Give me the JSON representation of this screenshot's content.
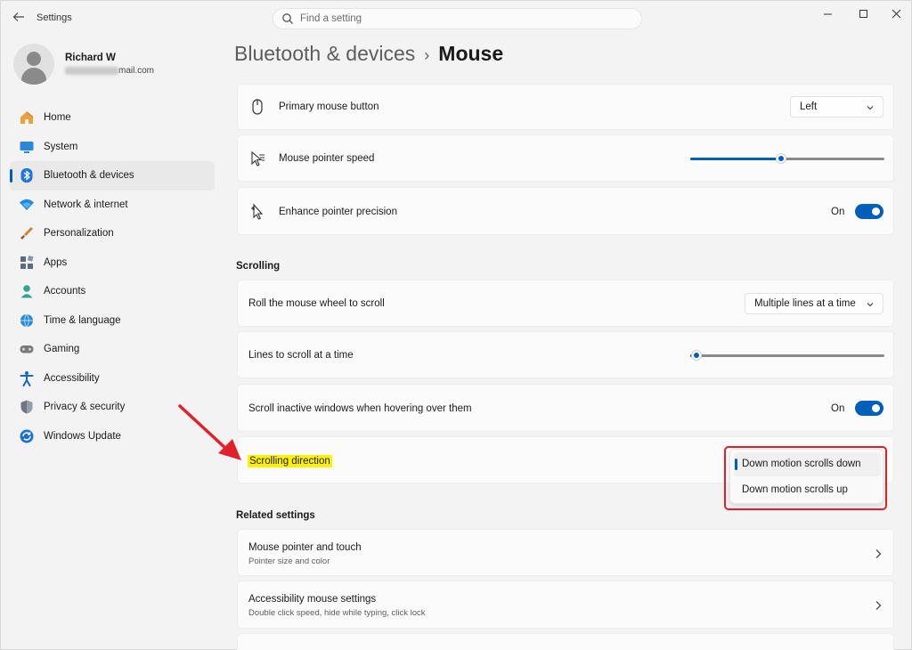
{
  "window": {
    "app_title": "Settings",
    "search_placeholder": "Find a setting"
  },
  "profile": {
    "name": "Richard W",
    "email_visible": "mail.com"
  },
  "sidebar": {
    "items": [
      {
        "label": "Home",
        "icon": "home-icon",
        "selected": false
      },
      {
        "label": "System",
        "icon": "system-icon",
        "selected": false
      },
      {
        "label": "Bluetooth & devices",
        "icon": "bluetooth-icon",
        "selected": true
      },
      {
        "label": "Network & internet",
        "icon": "network-icon",
        "selected": false
      },
      {
        "label": "Personalization",
        "icon": "personalization-icon",
        "selected": false
      },
      {
        "label": "Apps",
        "icon": "apps-icon",
        "selected": false
      },
      {
        "label": "Accounts",
        "icon": "accounts-icon",
        "selected": false
      },
      {
        "label": "Time & language",
        "icon": "time-language-icon",
        "selected": false
      },
      {
        "label": "Gaming",
        "icon": "gaming-icon",
        "selected": false
      },
      {
        "label": "Accessibility",
        "icon": "accessibility-icon",
        "selected": false
      },
      {
        "label": "Privacy & security",
        "icon": "shield-icon",
        "selected": false
      },
      {
        "label": "Windows Update",
        "icon": "windows-update-icon",
        "selected": false
      }
    ]
  },
  "header": {
    "parent": "Bluetooth & devices",
    "separator": "›",
    "current": "Mouse"
  },
  "settings": {
    "primary_button": {
      "label": "Primary mouse button",
      "value": "Left"
    },
    "pointer_speed": {
      "label": "Mouse pointer speed",
      "level": 0.47
    },
    "precision": {
      "label": "Enhance pointer precision",
      "state": "On"
    },
    "scrolling_section": "Scrolling",
    "roll_wheel": {
      "label": "Roll the mouse wheel to scroll",
      "value": "Multiple lines at a time"
    },
    "lines_to_scroll": {
      "label": "Lines to scroll at a time",
      "level": 0.03
    },
    "inactive_scroll": {
      "label": "Scroll inactive windows when hovering over them",
      "state": "On"
    },
    "scroll_direction": {
      "label": "Scrolling direction",
      "options": [
        "Down motion scrolls down",
        "Down motion scrolls up"
      ],
      "selected": "Down motion scrolls down"
    }
  },
  "related": {
    "title": "Related settings",
    "items": [
      {
        "label": "Mouse pointer and touch",
        "sub": "Pointer size and color"
      },
      {
        "label": "Accessibility mouse settings",
        "sub": "Double click speed, hide while typing, click lock"
      }
    ]
  },
  "colors": {
    "accent": "#005fb8",
    "annotation_red": "#e0202a",
    "highlight_yellow": "#fff200"
  }
}
